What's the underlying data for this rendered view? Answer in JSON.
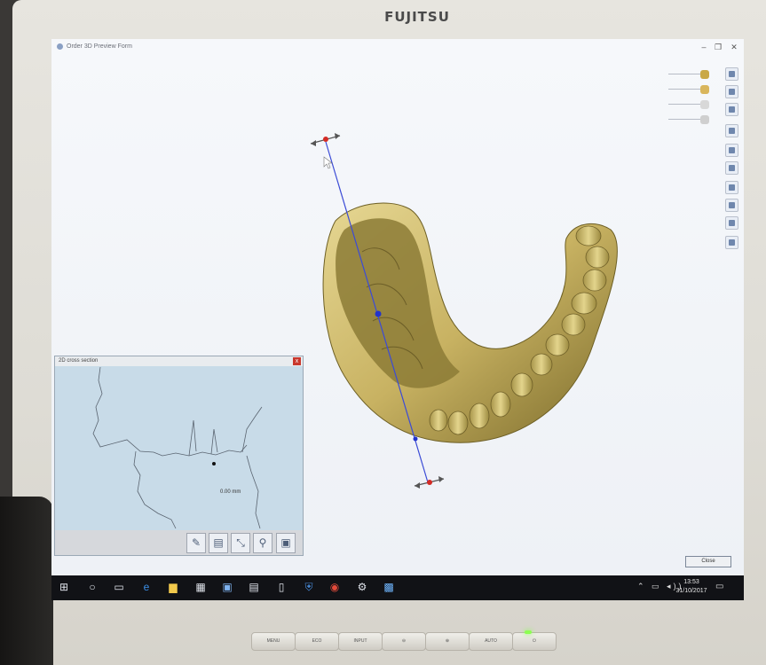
{
  "monitor": {
    "brand": "FUJITSU",
    "buttons": [
      "MENU",
      "ECO",
      "INPUT",
      "",
      "",
      "AUTO",
      ""
    ]
  },
  "window": {
    "title": "Order 3D Preview Form",
    "controls": {
      "minimize": "–",
      "maximize": "❐",
      "close": "✕"
    }
  },
  "cross_section": {
    "title": "2D cross section",
    "measurement": "0.00 mm",
    "close": "x",
    "tools": [
      "delete-marker-icon",
      "scanner-icon",
      "remove-measure-icon",
      "magnifier-icon",
      "model-icon"
    ]
  },
  "footer": {
    "close_label": "Close"
  },
  "taskbar": {
    "time": "13:53",
    "date": "31/10/2017",
    "icons": [
      "windows-start-icon",
      "search-icon",
      "task-view-icon",
      "edge-icon",
      "file-explorer-icon",
      "store-icon",
      "app-icon",
      "app-icon",
      "document-icon",
      "shield-icon",
      "chrome-icon",
      "app-icon",
      "app-icon"
    ]
  },
  "colors": {
    "model": "#c9b66a",
    "axis_line": "#3b4bd6",
    "handle_marker": "#d32b25",
    "screen_bg": "#f2f4f8",
    "taskbar_bg": "#111216"
  }
}
